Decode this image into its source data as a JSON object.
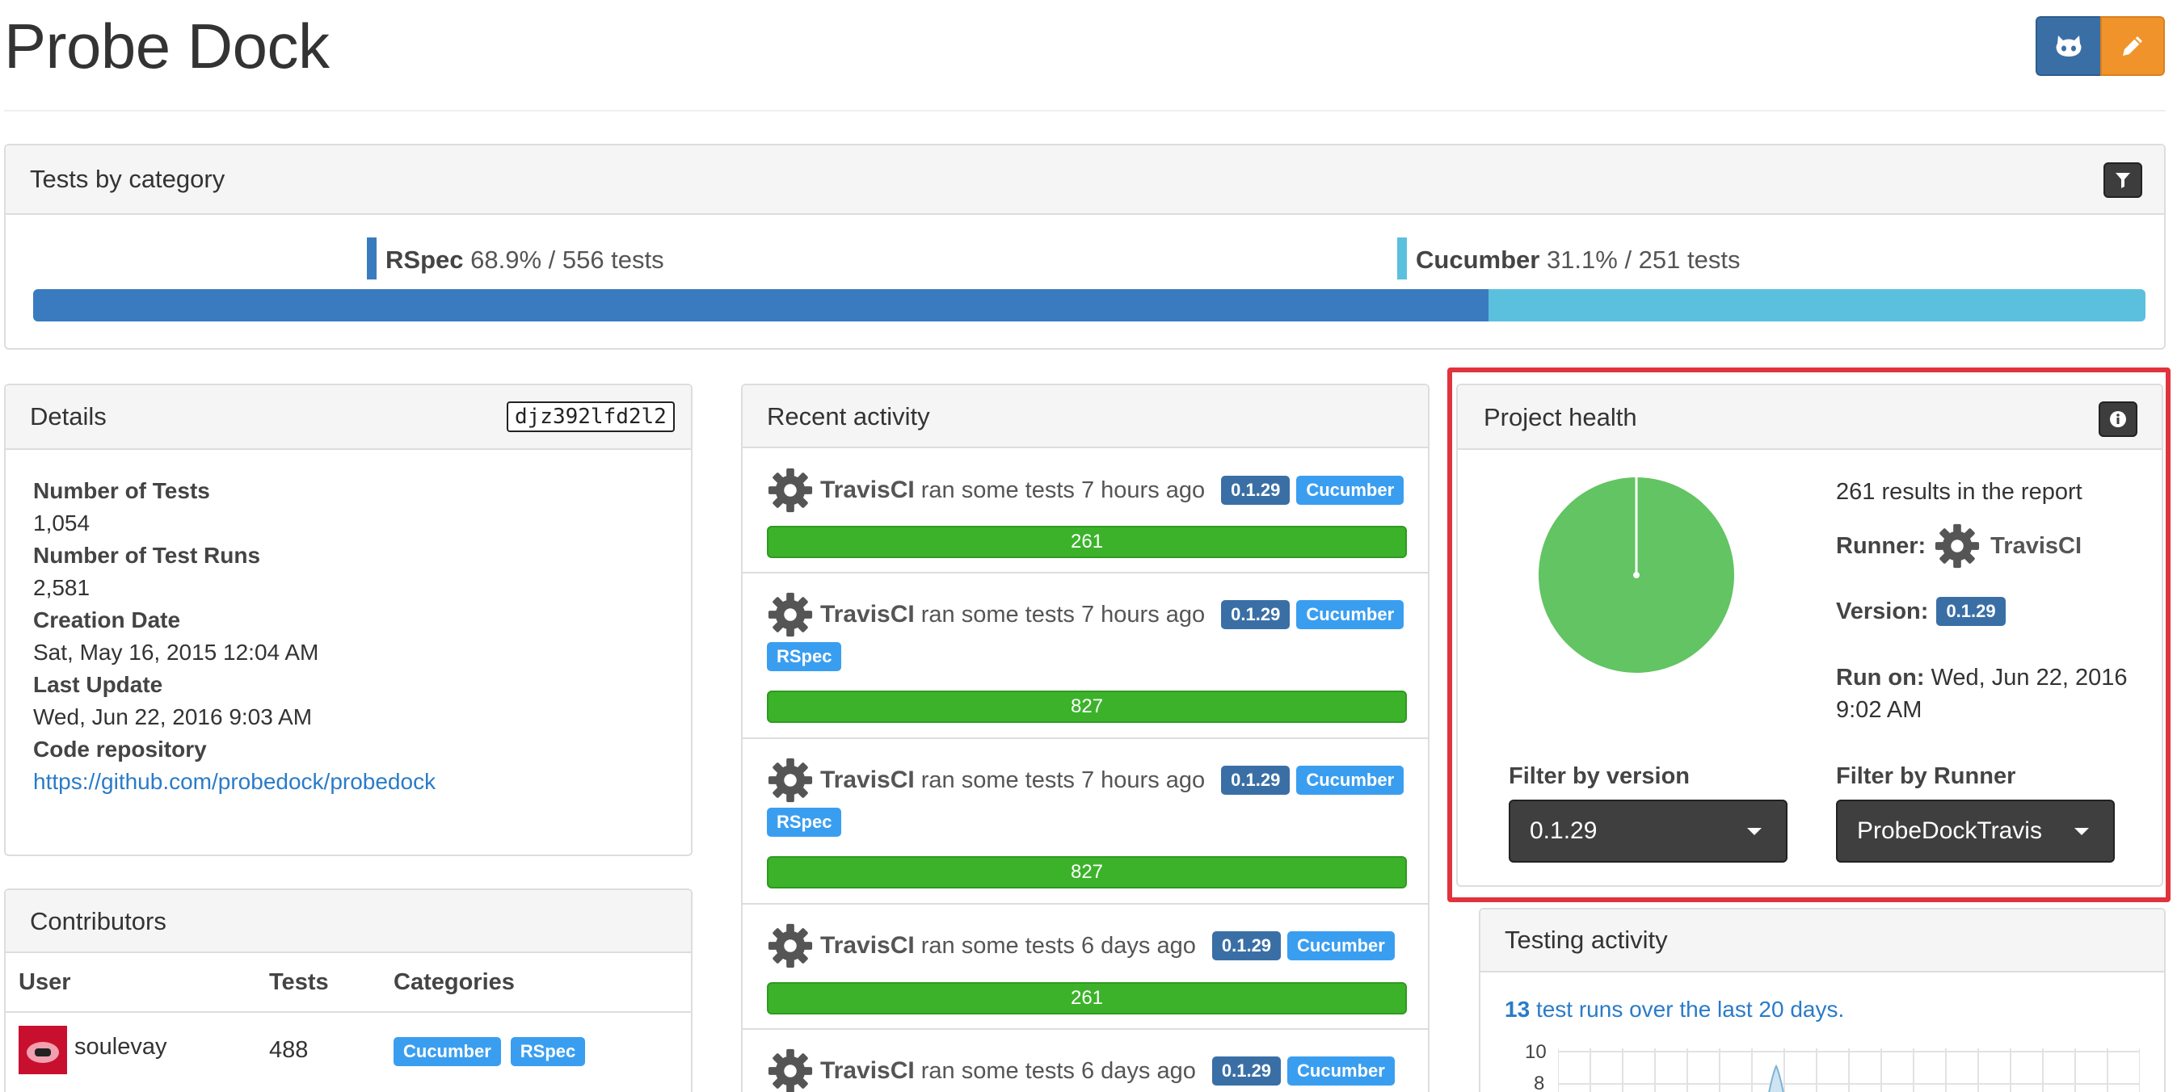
{
  "page": {
    "title": "Probe Dock",
    "buttons": {
      "github_icon": "github-octocat-icon",
      "edit_icon": "pencil-icon"
    }
  },
  "categories_panel": {
    "title": "Tests by category",
    "filter_icon": "filter-icon",
    "items": [
      {
        "name": "RSpec",
        "stats": "68.9% / 556 tests",
        "percent": 68.9,
        "color": "#3a7bbf"
      },
      {
        "name": "Cucumber",
        "stats": "31.1% / 251 tests",
        "percent": 31.1,
        "color": "#5bc0de"
      }
    ]
  },
  "details": {
    "title": "Details",
    "api_id": "djz392lfd2l2",
    "fields": [
      {
        "label": "Number of Tests",
        "value": "1,054"
      },
      {
        "label": "Number of Test Runs",
        "value": "2,581"
      },
      {
        "label": "Creation Date",
        "value": "Sat, May 16, 2015 12:04 AM"
      },
      {
        "label": "Last Update",
        "value": "Wed, Jun 22, 2016 9:03 AM"
      },
      {
        "label": "Code repository",
        "value": "https://github.com/probedock/probedock"
      }
    ]
  },
  "contributors": {
    "title": "Contributors",
    "columns": [
      "User",
      "Tests",
      "Categories"
    ],
    "rows": [
      {
        "user": "soulevay",
        "tests": "488",
        "categories": [
          "Cucumber",
          "RSpec"
        ]
      }
    ]
  },
  "activity": {
    "title": "Recent activity",
    "items": [
      {
        "runner": "TravisCI",
        "desc": "ran some tests 7 hours ago",
        "version": "0.1.29",
        "categories": [
          "Cucumber"
        ],
        "count": "261"
      },
      {
        "runner": "TravisCI",
        "desc": "ran some tests 7 hours ago",
        "version": "0.1.29",
        "categories": [
          "Cucumber",
          "RSpec"
        ],
        "count": "827"
      },
      {
        "runner": "TravisCI",
        "desc": "ran some tests 7 hours ago",
        "version": "0.1.29",
        "categories": [
          "Cucumber",
          "RSpec"
        ],
        "count": "827"
      },
      {
        "runner": "TravisCI",
        "desc": "ran some tests 6 days ago",
        "version": "0.1.29",
        "categories": [
          "Cucumber"
        ],
        "count": "261"
      },
      {
        "runner": "TravisCI",
        "desc": "ran some tests 6 days ago",
        "version": "0.1.29",
        "categories": [
          "Cucumber"
        ],
        "count": ""
      }
    ]
  },
  "health": {
    "title": "Project health",
    "info_icon": "info-icon",
    "results_link": "261 results in the report",
    "runner_label": "Runner:",
    "runner": "TravisCI",
    "version_label": "Version:",
    "version": "0.1.29",
    "run_on_label": "Run on:",
    "run_on_line1": "Wed, Jun 22, 2016",
    "run_on_line2": "9:02 AM",
    "filter_version_label": "Filter by version",
    "filter_version_value": "0.1.29",
    "filter_runner_label": "Filter by Runner",
    "filter_runner_value": "ProbeDockTravis",
    "pie_color": "#62c462"
  },
  "testing_activity": {
    "title": "Testing activity",
    "count": "13",
    "summary": "test runs over the last 20 days.",
    "y_ticks": [
      "10",
      "8"
    ]
  }
}
